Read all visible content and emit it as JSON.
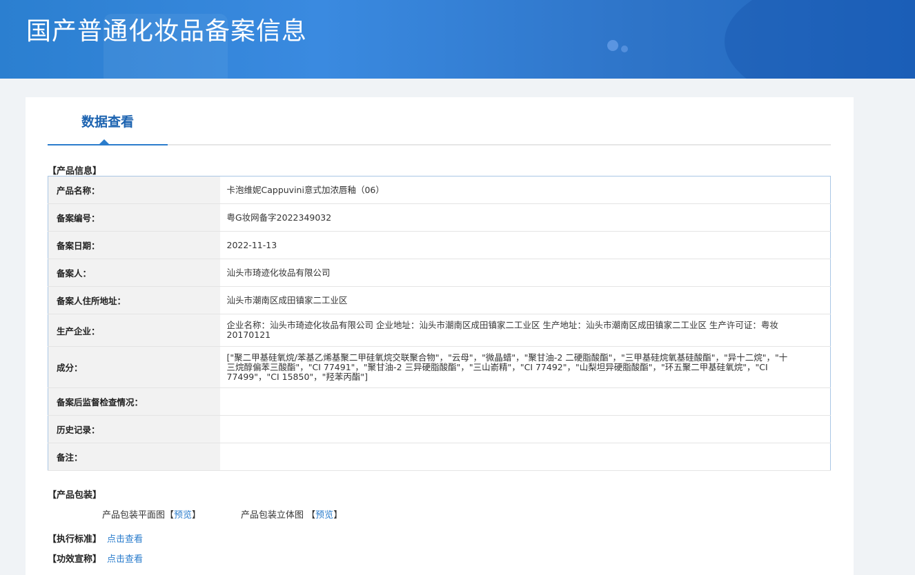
{
  "header": {
    "title": "国产普通化妆品备案信息"
  },
  "tabs": [
    {
      "label": "数据查看"
    }
  ],
  "product_info": {
    "section_label": "【产品信息】",
    "rows": [
      {
        "key": "产品名称：",
        "value": "卡泡维妮Cappuvini意式加浓唇釉（06）"
      },
      {
        "key": "备案编号：",
        "value": "粤G妆网备字2022349032"
      },
      {
        "key": "备案日期：",
        "value": "2022-11-13"
      },
      {
        "key": "备案人：",
        "value": "汕头市琦迹化妆品有限公司"
      },
      {
        "key": "备案人住所地址：",
        "value": "汕头市潮南区成田镇家二工业区"
      },
      {
        "key": "生产企业：",
        "value": "企业名称：汕头市琦迹化妆品有限公司 企业地址：汕头市潮南区成田镇家二工业区 生产地址：汕头市潮南区成田镇家二工业区 生产许可证：粤妆20170121"
      },
      {
        "key": "成分：",
        "value": "[\"聚二甲基硅氧烷/苯基乙烯基聚二甲硅氧烷交联聚合物\"，\"云母\"，\"微晶蜡\"，\"聚甘油-2 二硬脂酸酯\"，\"三甲基硅烷氧基硅酸酯\"，\"异十二烷\"，\"十三烷醇偏苯三酸酯\"，\"CI 77491\"，\"聚甘油-2 三异硬脂酸酯\"，\"三山嵛精\"，\"CI 77492\"，\"山梨坦异硬脂酸酯\"，\"环五聚二甲基硅氧烷\"，\"CI 77499\"，\"CI 15850\"，\"羟苯丙酯\"]"
      },
      {
        "key": "备案后监督检查情况：",
        "value": ""
      },
      {
        "key": "历史记录：",
        "value": ""
      },
      {
        "key": "备注：",
        "value": ""
      }
    ]
  },
  "packaging": {
    "section_label": "【产品包装】",
    "flat_label": "产品包装平面图",
    "flat_link": "预览",
    "solid_label": "产品包装立体图",
    "solid_link": "预览",
    "bracket_open": "【",
    "bracket_close": "】"
  },
  "standard": {
    "label": "【执行标准】",
    "link": "点击查看"
  },
  "efficacy": {
    "label": "【功效宣称】",
    "link": "点击查看"
  }
}
